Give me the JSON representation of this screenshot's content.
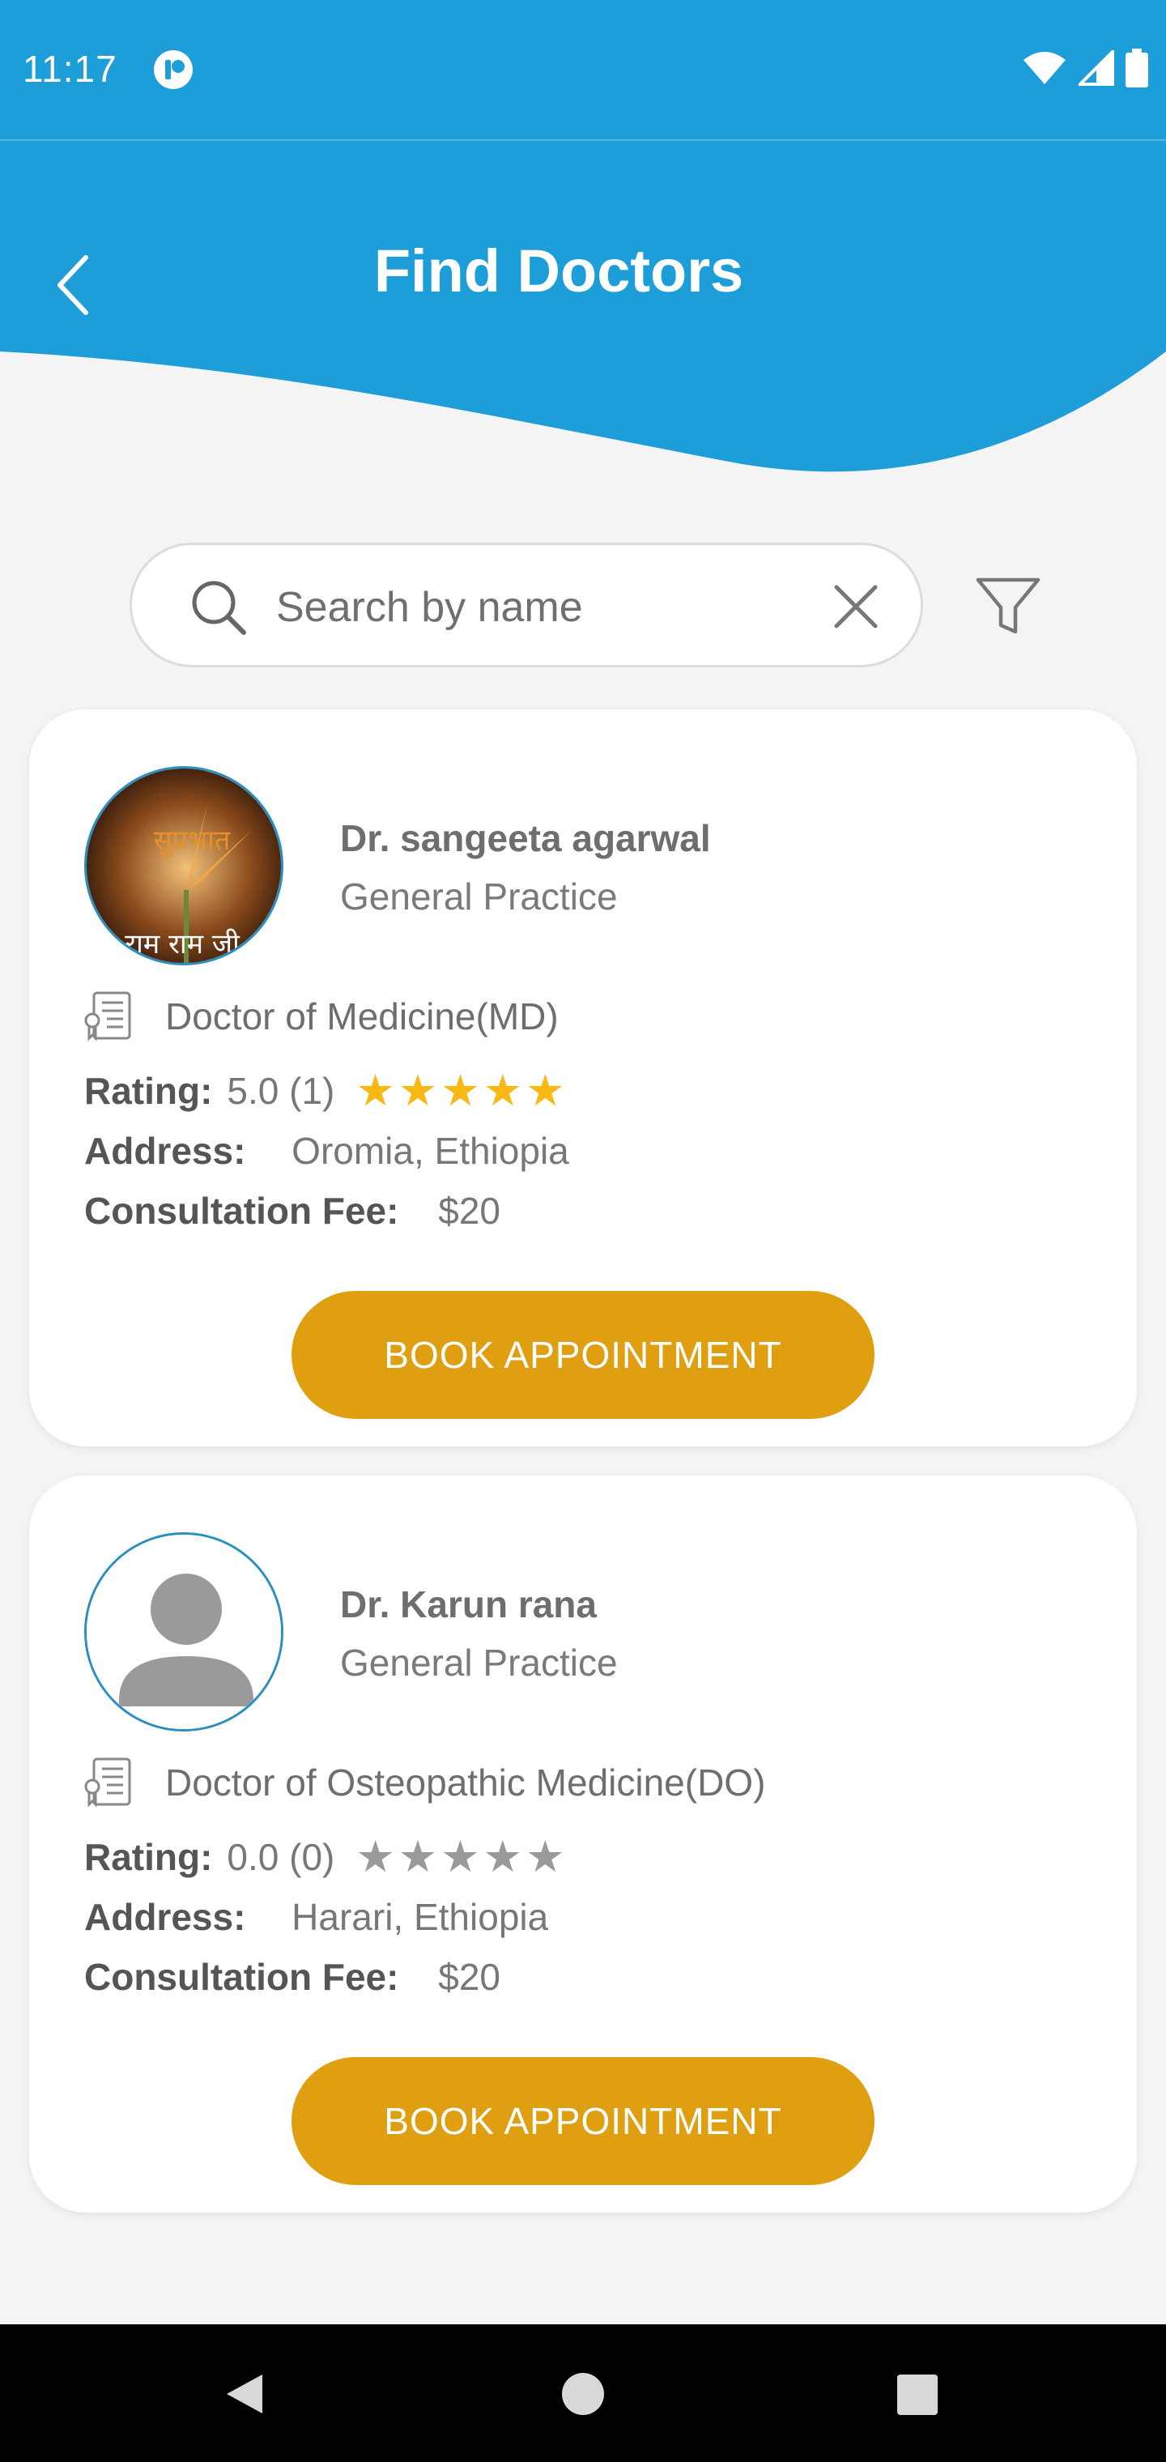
{
  "status_bar": {
    "time": "11:17",
    "icons": [
      "app-notification-icon",
      "wifi-icon",
      "signal-icon",
      "battery-icon"
    ]
  },
  "header": {
    "title": "Find Doctors",
    "back_icon": "chevron-left-icon",
    "background_color": "#1e9ed8"
  },
  "search": {
    "placeholder": "Search by name",
    "value": "",
    "icon": "search-icon",
    "clear_icon": "close-icon",
    "filter_icon": "filter-icon"
  },
  "labels": {
    "rating": "Rating:",
    "address": "Address:",
    "fee": "Consultation Fee:"
  },
  "doctors": [
    {
      "name": "Dr. sangeeta agarwal",
      "specialty": "General Practice",
      "degree": "Doctor of Medicine(MD)",
      "rating": "5.0 (1)",
      "stars_filled": 5,
      "address": "Oromia, Ethiopia",
      "fee": "$20",
      "button": "BOOK APPOINTMENT",
      "avatar_text_top": "सुप्रभात",
      "avatar_text_bottom": "राम राम जी"
    },
    {
      "name": "Dr. Karun rana",
      "specialty": "General Practice",
      "degree": "Doctor of Osteopathic Medicine(DO)",
      "rating": "0.0 (0)",
      "stars_filled": 0,
      "address": "Harari, Ethiopia",
      "fee": "$20",
      "button": "BOOK APPOINTMENT",
      "avatar_icon": "default-user-icon"
    }
  ],
  "colors": {
    "accent": "#df9f10",
    "star": "#f8b914",
    "star_empty": "#9a9a9a",
    "background": "#f4f4f4"
  }
}
